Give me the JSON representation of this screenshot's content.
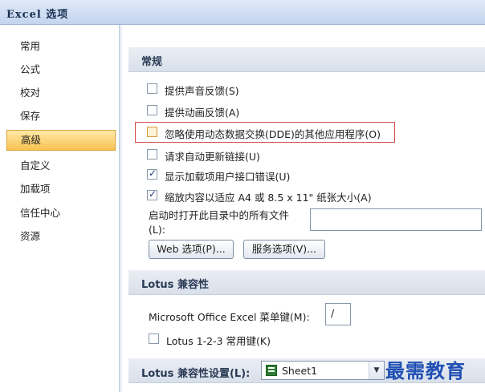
{
  "window": {
    "title": "Excel 选项"
  },
  "sidebar": {
    "items": [
      {
        "label": "常用"
      },
      {
        "label": "公式"
      },
      {
        "label": "校对"
      },
      {
        "label": "保存"
      },
      {
        "label": "高级",
        "selected": true
      },
      {
        "label": "自定义"
      },
      {
        "label": "加载项"
      },
      {
        "label": "信任中心"
      },
      {
        "label": "资源"
      }
    ]
  },
  "general": {
    "section_title": "常规",
    "options": [
      {
        "label": "提供声音反馈(S)",
        "checked": false
      },
      {
        "label": "提供动画反馈(A)",
        "checked": false
      },
      {
        "label": "忽略使用动态数据交换(DDE)的其他应用程序(O)",
        "checked": false,
        "highlighted": true
      },
      {
        "label": "请求自动更新链接(U)",
        "checked": false
      },
      {
        "label": "显示加载项用户接口错误(U)",
        "checked": true
      },
      {
        "label": "缩放内容以适应 A4 或 8.5 x 11\" 纸张大小(A)",
        "checked": true
      }
    ],
    "startup_label_line1": "启动时打开此目录中的所有文件",
    "startup_label_line2": "(L):",
    "startup_value": "",
    "web_options_button": "Web 选项(P)...",
    "service_options_button": "服务选项(V)..."
  },
  "lotus_compat": {
    "section_title": "Lotus 兼容性",
    "menu_key_label": "Microsoft Office Excel 菜单键(M):",
    "menu_key_value": "/",
    "nav_keys_label": "Lotus 1-2-3 常用键(K)",
    "nav_keys_checked": false
  },
  "lotus_settings": {
    "section_title": "Lotus 兼容性设置(L):",
    "sheet_value": "Sheet1"
  },
  "watermark": "最需教育",
  "colors": {
    "selected_nav": "#f8c24f",
    "highlight_border": "#d24b4b"
  }
}
